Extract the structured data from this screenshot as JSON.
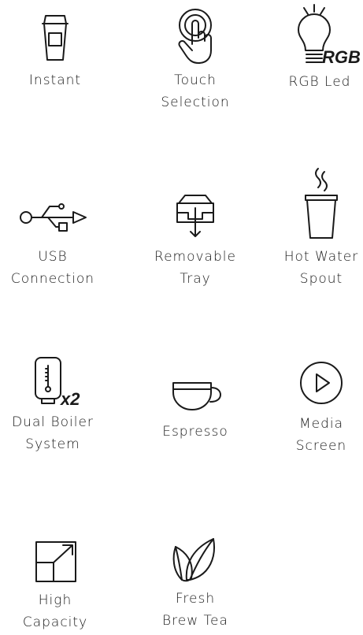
{
  "features": [
    {
      "line1": "Instant",
      "line2": "",
      "icon": "cup-icon"
    },
    {
      "line1": "Touch",
      "line2": "Selection",
      "icon": "touch-icon"
    },
    {
      "line1": "RGB Led",
      "line2": "",
      "icon": "bulb-icon",
      "icon_text": "RGB"
    },
    {
      "line1": "USB",
      "line2": "Connection",
      "icon": "usb-icon"
    },
    {
      "line1": "Removable",
      "line2": "Tray",
      "icon": "tray-icon"
    },
    {
      "line1": "Hot Water",
      "line2": "Spout",
      "icon": "hot-water-cup-icon"
    },
    {
      "line1": "Dual Boiler",
      "line2": "System",
      "icon": "boiler-icon",
      "icon_text": "x2"
    },
    {
      "line1": "Espresso",
      "line2": "",
      "icon": "espresso-cup-icon"
    },
    {
      "line1": "Media",
      "line2": "Screen",
      "icon": "play-icon"
    },
    {
      "line1": "High",
      "line2": "Capacity",
      "icon": "expand-icon"
    },
    {
      "line1": "Fresh",
      "line2": "Brew Tea",
      "icon": "leaves-icon"
    }
  ],
  "colors": {
    "stroke": "#1a1a1a",
    "background": "#ffffff"
  }
}
